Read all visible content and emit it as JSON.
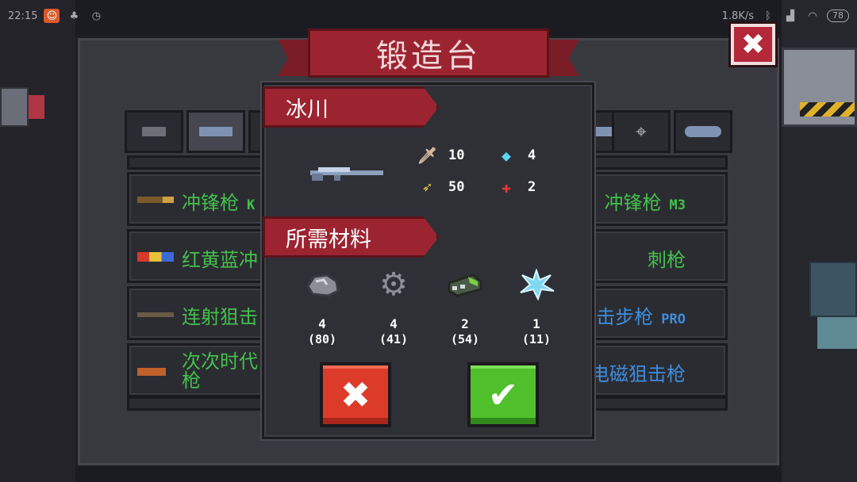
{
  "status_bar": {
    "time": "22:15",
    "network_speed": "1.8K/s",
    "battery": "78"
  },
  "forge": {
    "title": "锻造台",
    "close_glyph": "✖"
  },
  "tabs": [
    {
      "icon": "pistol-icon",
      "active": false
    },
    {
      "icon": "assault-rifle-icon",
      "active": true
    },
    {
      "icon": "rifle-icon",
      "active": false
    },
    {
      "icon": "sniper-icon",
      "active": false
    },
    {
      "icon": "crosshair-icon",
      "active": false
    },
    {
      "icon": "fish-gun-icon",
      "active": false
    }
  ],
  "weapon_rows": [
    {
      "left_name": "冲锋枪",
      "left_tag": "K",
      "right_name": "冲锋枪",
      "right_tag": "M3",
      "right_color": "green"
    },
    {
      "left_name": "红黄蓝冲",
      "left_tag": "",
      "right_name": "刺枪",
      "right_tag": "",
      "right_color": "green"
    },
    {
      "left_name": "连射狙击",
      "left_tag": "",
      "right_name": "突击步枪",
      "right_tag": "PRO",
      "right_color": "blue"
    },
    {
      "left_name": "次次时代枪",
      "left_tag": "",
      "right_name": "电磁狙击枪",
      "right_tag": "",
      "right_color": "blue"
    }
  ],
  "dialog": {
    "weapon_name": "冰川",
    "stats": {
      "damage": "10",
      "energy": "4",
      "fire_rate": "50",
      "accuracy": "2"
    },
    "materials_title": "所需材料",
    "materials": [
      {
        "name": "ore-icon",
        "need": "4",
        "have": "(80)"
      },
      {
        "name": "gear-icon",
        "need": "4",
        "have": "(41)"
      },
      {
        "name": "battery-part-icon",
        "need": "2",
        "have": "(54)"
      },
      {
        "name": "ice-crystal-icon",
        "need": "1",
        "have": "(11)"
      }
    ],
    "cancel_glyph": "✖",
    "confirm_glyph": "✔"
  }
}
